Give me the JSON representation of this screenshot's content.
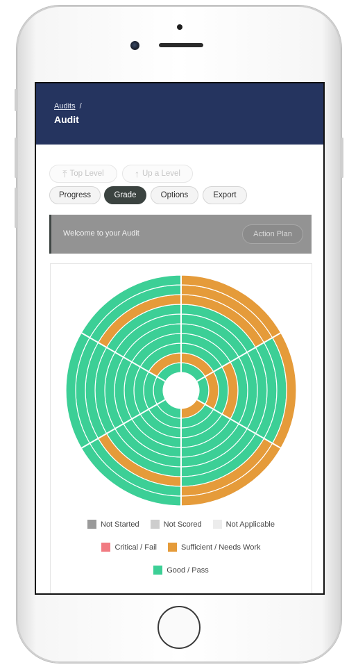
{
  "breadcrumb": {
    "link": "Audits",
    "separator": "/"
  },
  "page": {
    "title": "Audit"
  },
  "nav": {
    "top_level": "Top Level",
    "up_level": "Up a Level",
    "top_level_icon": "arrow-to-top-icon",
    "up_level_icon": "arrow-up-icon"
  },
  "tabs": [
    {
      "label": "Progress",
      "active": false
    },
    {
      "label": "Grade",
      "active": true
    },
    {
      "label": "Options",
      "active": false
    },
    {
      "label": "Export",
      "active": false
    }
  ],
  "banner": {
    "text": "Welcome to your Audit",
    "button": "Action Plan"
  },
  "colors": {
    "header": "#25345f",
    "good": "#3ccf96",
    "sufficient": "#e59b3a",
    "critical": "#f17b82",
    "not_started": "#9a9a9a",
    "not_scored": "#cdcdcd",
    "not_applicable": "#ececec"
  },
  "chart_data": {
    "type": "sunburst",
    "center_radius": 1,
    "rings": 10,
    "sectors": [
      {
        "start_deg": 0,
        "end_deg": 60,
        "statuses": [
          "good",
          "sufficient",
          "good",
          "good",
          "good",
          "good",
          "good",
          "sufficient",
          "sufficient",
          "sufficient"
        ]
      },
      {
        "start_deg": 60,
        "end_deg": 120,
        "statuses": [
          "good",
          "sufficient",
          "good",
          "sufficient",
          "good",
          "good",
          "good",
          "good",
          "good",
          "sufficient"
        ]
      },
      {
        "start_deg": 120,
        "end_deg": 180,
        "statuses": [
          "sufficient",
          "good",
          "good",
          "good",
          "good",
          "good",
          "good",
          "good",
          "sufficient",
          "sufficient"
        ]
      },
      {
        "start_deg": 180,
        "end_deg": 240,
        "statuses": [
          "good",
          "good",
          "good",
          "good",
          "good",
          "good",
          "good",
          "sufficient",
          "good",
          "good"
        ]
      },
      {
        "start_deg": 240,
        "end_deg": 300,
        "statuses": [
          "good",
          "good",
          "good",
          "good",
          "good",
          "good",
          "good",
          "good",
          "good",
          "good"
        ]
      },
      {
        "start_deg": 300,
        "end_deg": 360,
        "statuses": [
          "good",
          "sufficient",
          "good",
          "good",
          "good",
          "good",
          "good",
          "sufficient",
          "good",
          "good"
        ]
      }
    ],
    "legend": [
      {
        "key": "not_started",
        "label": "Not Started"
      },
      {
        "key": "not_scored",
        "label": "Not Scored"
      },
      {
        "key": "not_applicable",
        "label": "Not Applicable"
      },
      {
        "key": "critical",
        "label": "Critical / Fail"
      },
      {
        "key": "sufficient",
        "label": "Sufficient / Needs Work"
      },
      {
        "key": "good",
        "label": "Good / Pass"
      }
    ]
  }
}
